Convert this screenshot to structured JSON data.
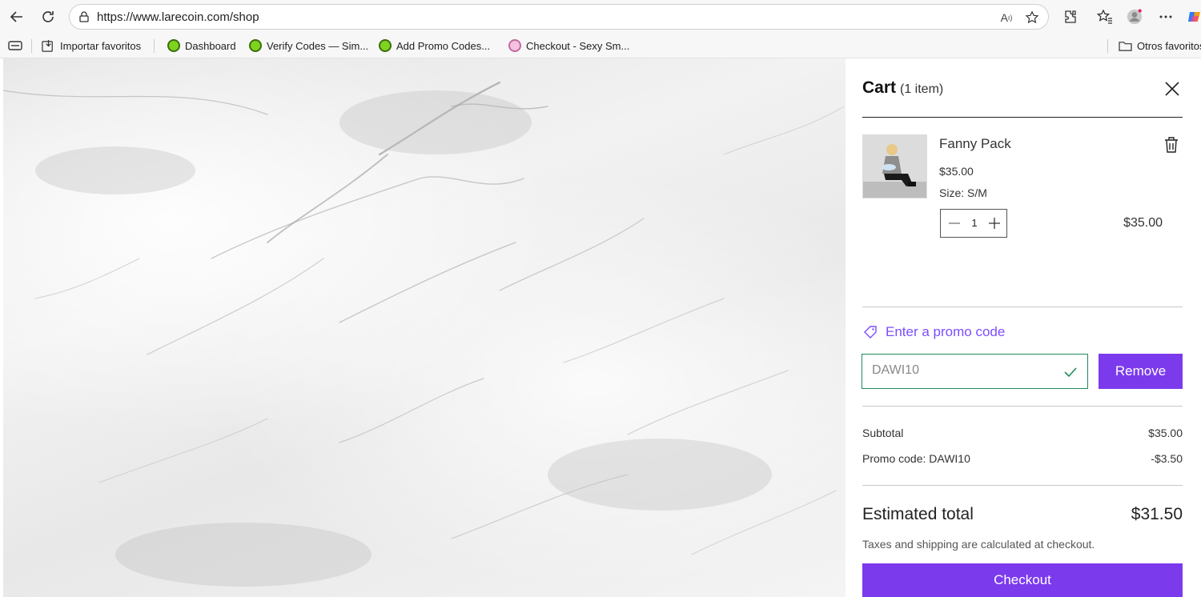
{
  "browser": {
    "url": "https://www.larecoin.com/shop",
    "bookmarks": [
      {
        "label": "Importar favoritos",
        "icon": "import-favorites-icon"
      },
      {
        "label": "Dashboard",
        "icon": "site-favicon"
      },
      {
        "label": "Verify Codes — Sim...",
        "icon": "site-favicon"
      },
      {
        "label": "Add Promo Codes...",
        "icon": "site-favicon"
      },
      {
        "label": "Checkout - Sexy Sm...",
        "icon": "site-favicon"
      }
    ],
    "other_favorites": "Otros favoritos"
  },
  "cart": {
    "title": "Cart",
    "count_label": "(1 item)",
    "items": [
      {
        "name": "Fanny Pack",
        "price": "$35.00",
        "size": "Size: S/M",
        "quantity": "1",
        "line_total": "$35.00"
      }
    ],
    "promo": {
      "link_label": "Enter a promo code",
      "input_value": "DAWI10",
      "remove_label": "Remove"
    },
    "summary": {
      "subtotal_label": "Subtotal",
      "subtotal_value": "$35.00",
      "promo_label": "Promo code: DAWI10",
      "promo_value": "-$3.50"
    },
    "estimated_total_label": "Estimated total",
    "estimated_total_value": "$31.50",
    "tax_note": "Taxes and shipping are calculated at checkout.",
    "checkout_label": "Checkout"
  },
  "colors": {
    "accent": "#7c3aed",
    "promo_link": "#7c4dff",
    "valid_border": "#1f8a5b"
  }
}
